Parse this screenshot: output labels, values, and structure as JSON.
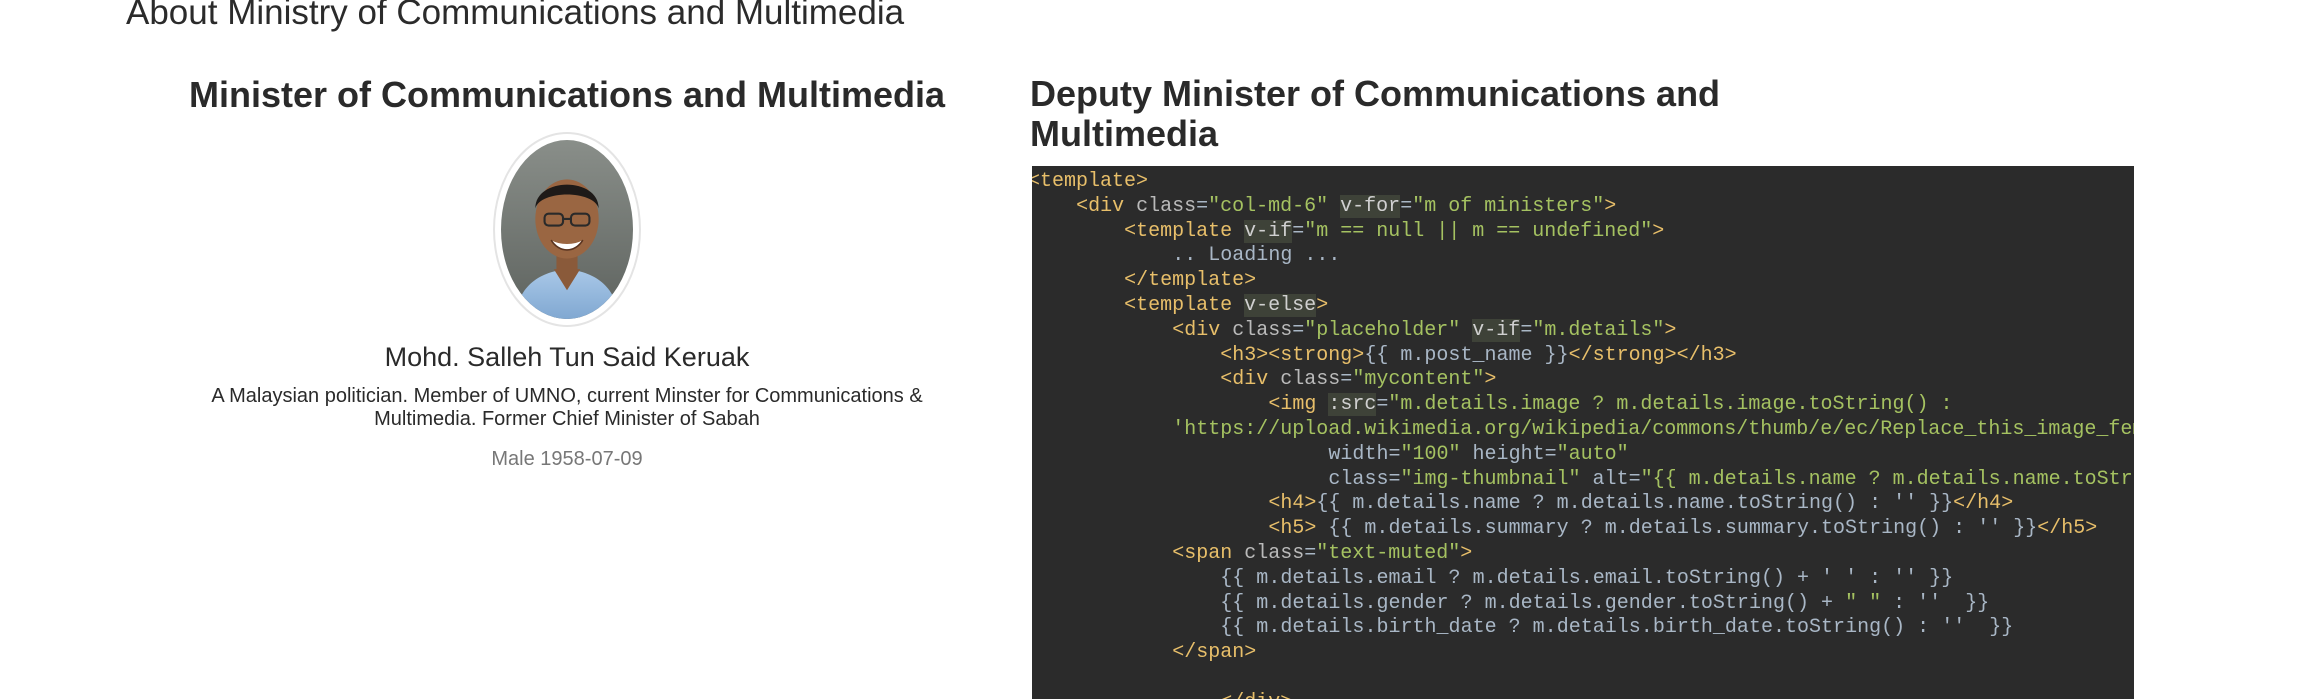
{
  "page": {
    "heading": "About Ministry of Communications and Multimedia"
  },
  "minister": {
    "title": "Minister of Communications and Multimedia",
    "name": "Mohd. Salleh Tun Said Keruak",
    "summary": "A Malaysian politician. Member of UMNO, current Minster for Communications & Multimedia. Former Chief Minister of Sabah",
    "meta": "Male 1958-07-09"
  },
  "deputy": {
    "title": "Deputy Minister of Communications and Multimedia"
  },
  "code": {
    "lines": [
      "<template>",
      "    <div class=\"col-md-6\" v-for=\"m of ministers\">",
      "        <template v-if=\"m == null || m == undefined\">",
      "            .. Loading ...",
      "        </template>",
      "        <template v-else>",
      "            <div class=\"placeholder\" v-if=\"m.details\">",
      "                <h3><strong>{{ m.post_name }}</strong></h3>",
      "                <div class=\"mycontent\">",
      "                    <img :src=\"m.details.image ? m.details.image.toString() :",
      "            'https://upload.wikimedia.org/wikipedia/commons/thumb/e/ec/Replace_this_image_female",
      "                         width=\"100\" height=\"auto\"",
      "                         class=\"img-thumbnail\" alt=\"{{ m.details.name ? m.details.name.toString(",
      "                    <h4>{{ m.details.name ? m.details.name.toString() : '' }}</h4>",
      "                    <h5> {{ m.details.summary ? m.details.summary.toString() : '' }}</h5>",
      "            <span class=\"text-muted\">",
      "                {{ m.details.email ? m.details.email.toString() + ' ' : '' }}",
      "                {{ m.details.gender ? m.details.gender.toString() + \" \" : ''  }}",
      "                {{ m.details.birth_date ? m.details.birth_date.toString() : ''  }}",
      "            </span>",
      "",
      "                </div>"
    ]
  },
  "colors": {
    "code_background": "#2b2b2b",
    "code_tag": "#e8bf6a",
    "code_string": "#a5c261",
    "code_text": "#a9b7c6",
    "meta_text": "#777777"
  }
}
